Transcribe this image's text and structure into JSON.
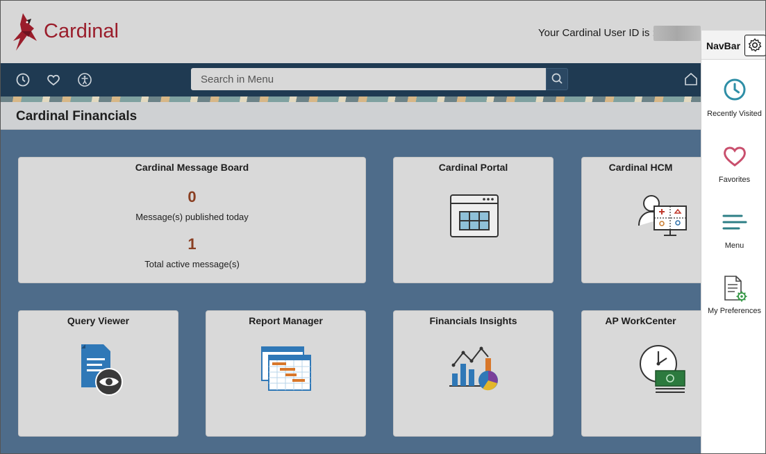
{
  "header": {
    "brand": "Cardinal",
    "user_id_label": "Your Cardinal User ID is :"
  },
  "toolbar": {
    "search_placeholder": "Search in Menu",
    "icons": [
      "history-icon",
      "favorites-icon",
      "accessibility-icon",
      "search-icon",
      "home-icon"
    ]
  },
  "page": {
    "title": "Cardinal Financials"
  },
  "tiles": {
    "message_board": {
      "title": "Cardinal Message Board",
      "published_count": "0",
      "published_label": "Message(s) published today",
      "active_count": "1",
      "active_label": "Total active message(s)"
    },
    "portal": {
      "title": "Cardinal Portal"
    },
    "hcm": {
      "title": "Cardinal HCM"
    },
    "query_viewer": {
      "title": "Query Viewer"
    },
    "report_manager": {
      "title": "Report Manager"
    },
    "financials_insights": {
      "title": "Financials Insights"
    },
    "ap_workcenter": {
      "title": "AP WorkCenter"
    }
  },
  "navbar": {
    "title": "NavBar",
    "items": [
      {
        "label": "Recently Visited",
        "icon": "clock-icon"
      },
      {
        "label": "Favorites",
        "icon": "heart-icon"
      },
      {
        "label": "Menu",
        "icon": "menu-icon"
      },
      {
        "label": "My Preferences",
        "icon": "preferences-icon"
      }
    ]
  },
  "colors": {
    "brand_red": "#9a1d2b",
    "toolbar": "#1f3a52",
    "content_bg": "#4e6c8a",
    "navbar_accent": "#2e8ea6",
    "count_color": "#8a3f22"
  }
}
